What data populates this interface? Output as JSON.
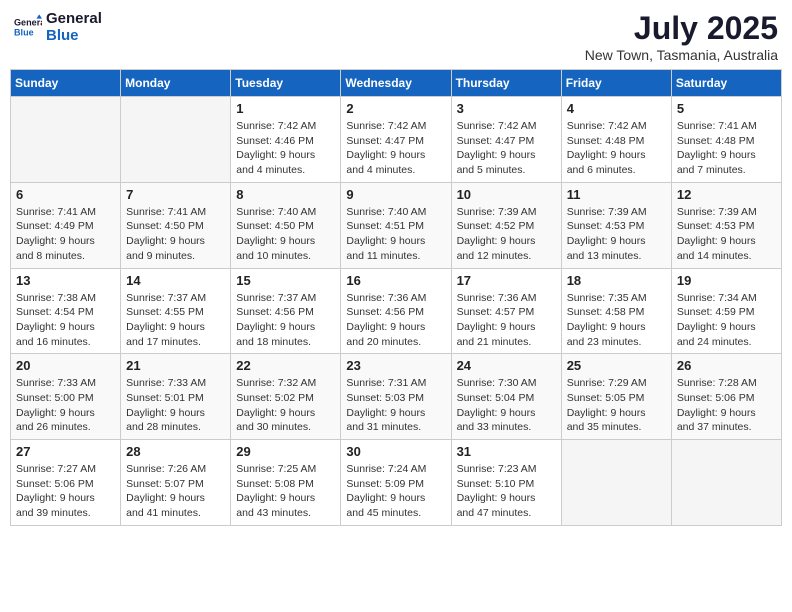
{
  "header": {
    "logo_line1": "General",
    "logo_line2": "Blue",
    "month": "July 2025",
    "location": "New Town, Tasmania, Australia"
  },
  "weekdays": [
    "Sunday",
    "Monday",
    "Tuesday",
    "Wednesday",
    "Thursday",
    "Friday",
    "Saturday"
  ],
  "weeks": [
    [
      {
        "day": "",
        "info": ""
      },
      {
        "day": "",
        "info": ""
      },
      {
        "day": "1",
        "info": "Sunrise: 7:42 AM\nSunset: 4:46 PM\nDaylight: 9 hours\nand 4 minutes."
      },
      {
        "day": "2",
        "info": "Sunrise: 7:42 AM\nSunset: 4:47 PM\nDaylight: 9 hours\nand 4 minutes."
      },
      {
        "day": "3",
        "info": "Sunrise: 7:42 AM\nSunset: 4:47 PM\nDaylight: 9 hours\nand 5 minutes."
      },
      {
        "day": "4",
        "info": "Sunrise: 7:42 AM\nSunset: 4:48 PM\nDaylight: 9 hours\nand 6 minutes."
      },
      {
        "day": "5",
        "info": "Sunrise: 7:41 AM\nSunset: 4:48 PM\nDaylight: 9 hours\nand 7 minutes."
      }
    ],
    [
      {
        "day": "6",
        "info": "Sunrise: 7:41 AM\nSunset: 4:49 PM\nDaylight: 9 hours\nand 8 minutes."
      },
      {
        "day": "7",
        "info": "Sunrise: 7:41 AM\nSunset: 4:50 PM\nDaylight: 9 hours\nand 9 minutes."
      },
      {
        "day": "8",
        "info": "Sunrise: 7:40 AM\nSunset: 4:50 PM\nDaylight: 9 hours\nand 10 minutes."
      },
      {
        "day": "9",
        "info": "Sunrise: 7:40 AM\nSunset: 4:51 PM\nDaylight: 9 hours\nand 11 minutes."
      },
      {
        "day": "10",
        "info": "Sunrise: 7:39 AM\nSunset: 4:52 PM\nDaylight: 9 hours\nand 12 minutes."
      },
      {
        "day": "11",
        "info": "Sunrise: 7:39 AM\nSunset: 4:53 PM\nDaylight: 9 hours\nand 13 minutes."
      },
      {
        "day": "12",
        "info": "Sunrise: 7:39 AM\nSunset: 4:53 PM\nDaylight: 9 hours\nand 14 minutes."
      }
    ],
    [
      {
        "day": "13",
        "info": "Sunrise: 7:38 AM\nSunset: 4:54 PM\nDaylight: 9 hours\nand 16 minutes."
      },
      {
        "day": "14",
        "info": "Sunrise: 7:37 AM\nSunset: 4:55 PM\nDaylight: 9 hours\nand 17 minutes."
      },
      {
        "day": "15",
        "info": "Sunrise: 7:37 AM\nSunset: 4:56 PM\nDaylight: 9 hours\nand 18 minutes."
      },
      {
        "day": "16",
        "info": "Sunrise: 7:36 AM\nSunset: 4:56 PM\nDaylight: 9 hours\nand 20 minutes."
      },
      {
        "day": "17",
        "info": "Sunrise: 7:36 AM\nSunset: 4:57 PM\nDaylight: 9 hours\nand 21 minutes."
      },
      {
        "day": "18",
        "info": "Sunrise: 7:35 AM\nSunset: 4:58 PM\nDaylight: 9 hours\nand 23 minutes."
      },
      {
        "day": "19",
        "info": "Sunrise: 7:34 AM\nSunset: 4:59 PM\nDaylight: 9 hours\nand 24 minutes."
      }
    ],
    [
      {
        "day": "20",
        "info": "Sunrise: 7:33 AM\nSunset: 5:00 PM\nDaylight: 9 hours\nand 26 minutes."
      },
      {
        "day": "21",
        "info": "Sunrise: 7:33 AM\nSunset: 5:01 PM\nDaylight: 9 hours\nand 28 minutes."
      },
      {
        "day": "22",
        "info": "Sunrise: 7:32 AM\nSunset: 5:02 PM\nDaylight: 9 hours\nand 30 minutes."
      },
      {
        "day": "23",
        "info": "Sunrise: 7:31 AM\nSunset: 5:03 PM\nDaylight: 9 hours\nand 31 minutes."
      },
      {
        "day": "24",
        "info": "Sunrise: 7:30 AM\nSunset: 5:04 PM\nDaylight: 9 hours\nand 33 minutes."
      },
      {
        "day": "25",
        "info": "Sunrise: 7:29 AM\nSunset: 5:05 PM\nDaylight: 9 hours\nand 35 minutes."
      },
      {
        "day": "26",
        "info": "Sunrise: 7:28 AM\nSunset: 5:06 PM\nDaylight: 9 hours\nand 37 minutes."
      }
    ],
    [
      {
        "day": "27",
        "info": "Sunrise: 7:27 AM\nSunset: 5:06 PM\nDaylight: 9 hours\nand 39 minutes."
      },
      {
        "day": "28",
        "info": "Sunrise: 7:26 AM\nSunset: 5:07 PM\nDaylight: 9 hours\nand 41 minutes."
      },
      {
        "day": "29",
        "info": "Sunrise: 7:25 AM\nSunset: 5:08 PM\nDaylight: 9 hours\nand 43 minutes."
      },
      {
        "day": "30",
        "info": "Sunrise: 7:24 AM\nSunset: 5:09 PM\nDaylight: 9 hours\nand 45 minutes."
      },
      {
        "day": "31",
        "info": "Sunrise: 7:23 AM\nSunset: 5:10 PM\nDaylight: 9 hours\nand 47 minutes."
      },
      {
        "day": "",
        "info": ""
      },
      {
        "day": "",
        "info": ""
      }
    ]
  ]
}
